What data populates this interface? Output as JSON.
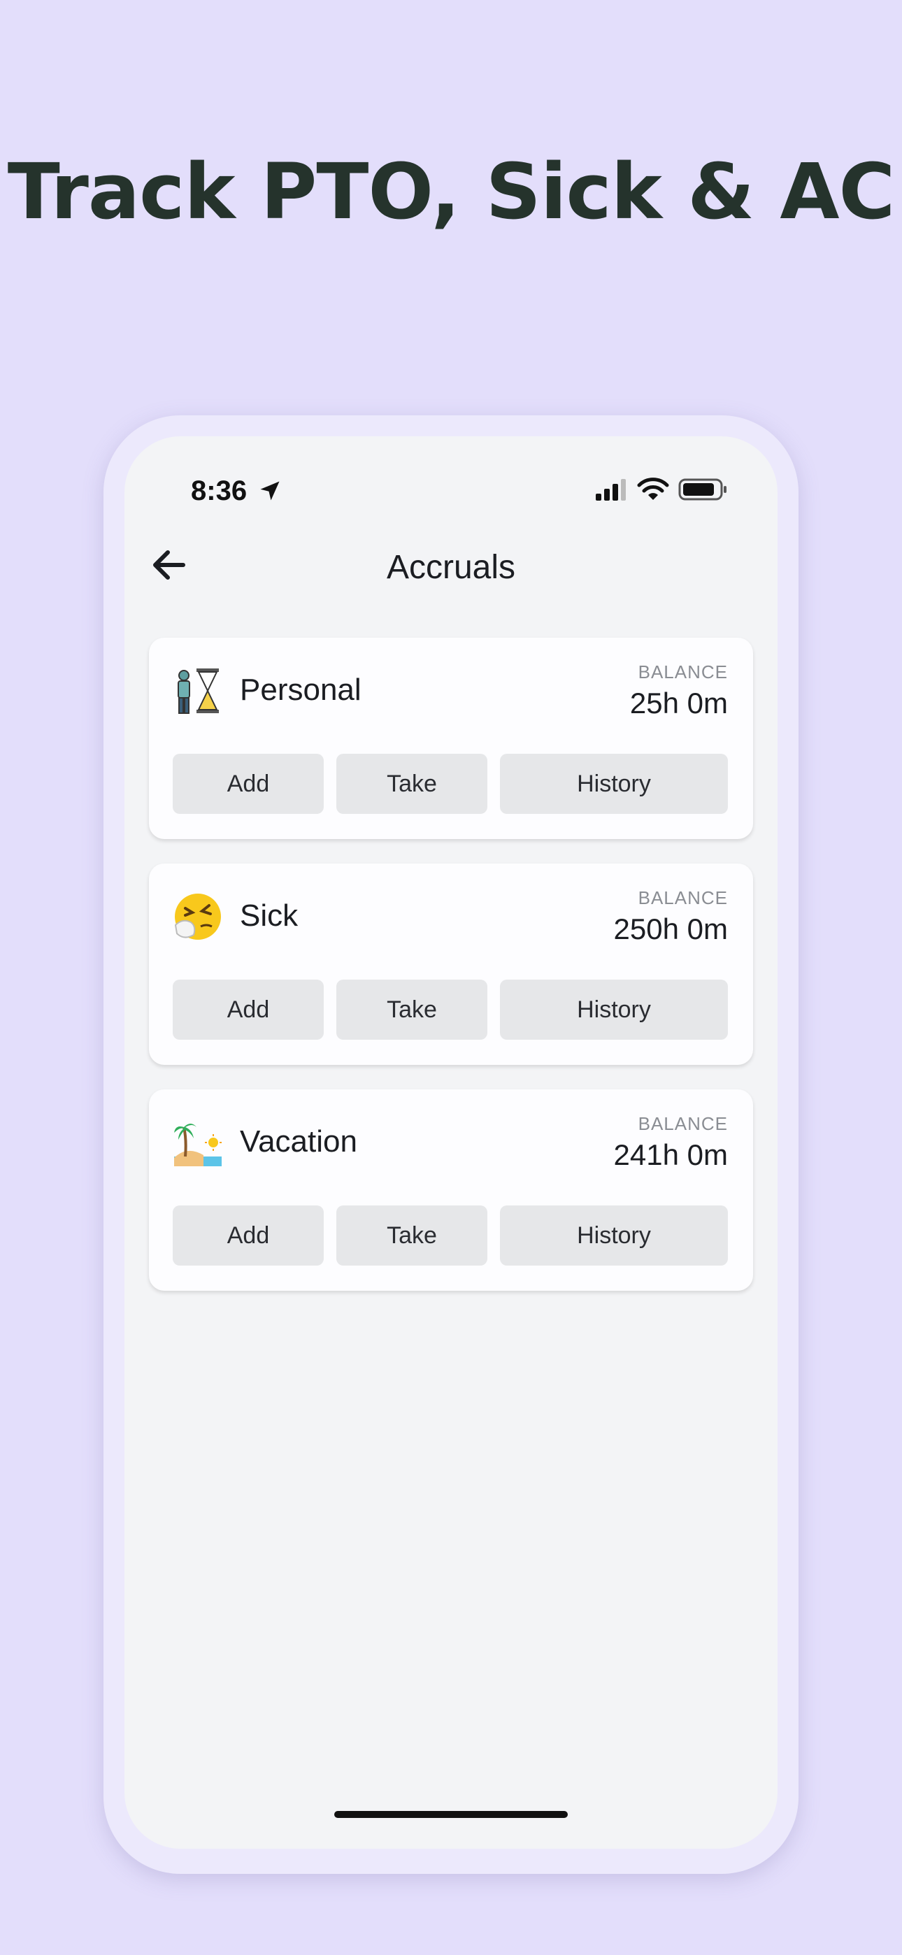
{
  "headline": "Track PTO, Sick  & AC",
  "status_bar": {
    "time": "8:36",
    "icons": [
      "location-arrow-icon",
      "cellular-signal-icon",
      "wifi-icon",
      "battery-icon"
    ]
  },
  "nav": {
    "title": "Accruals",
    "back_icon": "back-arrow-icon"
  },
  "cards": [
    {
      "name": "Personal",
      "icon": "hourglass-person-icon",
      "balance_label": "BALANCE",
      "balance": "25h 0m",
      "buttons": {
        "add": "Add",
        "take": "Take",
        "history": "History"
      }
    },
    {
      "name": "Sick",
      "icon": "sneezing-face-icon",
      "balance_label": "BALANCE",
      "balance": "250h 0m",
      "buttons": {
        "add": "Add",
        "take": "Take",
        "history": "History"
      }
    },
    {
      "name": "Vacation",
      "icon": "beach-palm-icon",
      "balance_label": "BALANCE",
      "balance": "241h 0m",
      "buttons": {
        "add": "Add",
        "take": "Take",
        "history": "History"
      }
    }
  ],
  "colors": {
    "background": "#e3defb",
    "screen": "#f3f4f6",
    "card": "#fdfdff",
    "button": "#e6e7e9",
    "headline": "#25332c"
  }
}
